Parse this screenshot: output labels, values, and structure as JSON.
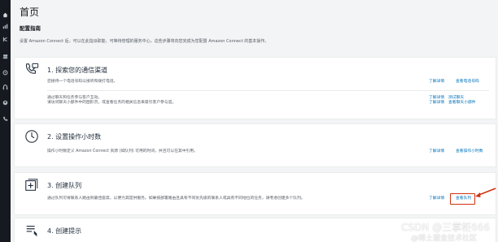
{
  "page": {
    "title": "首页",
    "section_title": "配置指南",
    "intro": "设置 Amazon Connect 后，可以在此指派职能、可等待管理的服务中心，这些步骤将向您完成为您配置 Amazon Connect 的基本操作。"
  },
  "steps": [
    {
      "title": "1. 探索您的通信渠道",
      "icon": "phone-chat-icon",
      "rows": [
        {
          "desc": "您接待一个电话号码以接听和拨打电话。",
          "learn": "了解详情",
          "action": "查看电话号码"
        },
        {
          "desc": "通过聊天和任务参与客户互动。\n请访问聊天小部件中的图形页，或查看任务的相关信息来吸引客户参与度。",
          "learn": "了解详情\n了解详情",
          "action": "测试聊天\n查看聊天小部件"
        }
      ]
    },
    {
      "title": "2. 设置操作小时数",
      "icon": "clock-icon",
      "rows": [
        {
          "desc": "操作小时数定义 Amazon Connect 资源 (如队列) 可用的时间，并且可以在其中引用。",
          "learn": "了解详情",
          "action": "查看操作小时数"
        }
      ]
    },
    {
      "title": "3. 创建队列",
      "icon": "add-queue-icon",
      "rows": [
        {
          "desc": "通过队列可将联系人路由到最佳座席，以便为其提供服务。如果按部署路由且具有不同优先级的联系人或具有不同地位的任务，请考虑创建多个队列。",
          "learn": "了解详情",
          "action": "查看队列"
        }
      ]
    },
    {
      "title": "4. 创建提示",
      "icon": "prompt-icon",
      "rows": []
    }
  ],
  "watermark": {
    "line1": "CSDN @三掌柜666",
    "line2": "@稀土掘金技术社区"
  },
  "colors": {
    "rail": "#16191f",
    "link": "#0073bb",
    "highlight": "#d13212"
  },
  "rail_icons": [
    "home-icon",
    "chart-icon",
    "routing-icon",
    "users-icon",
    "flows-icon",
    "headset-icon",
    "profile-icon",
    "phone-icon"
  ]
}
